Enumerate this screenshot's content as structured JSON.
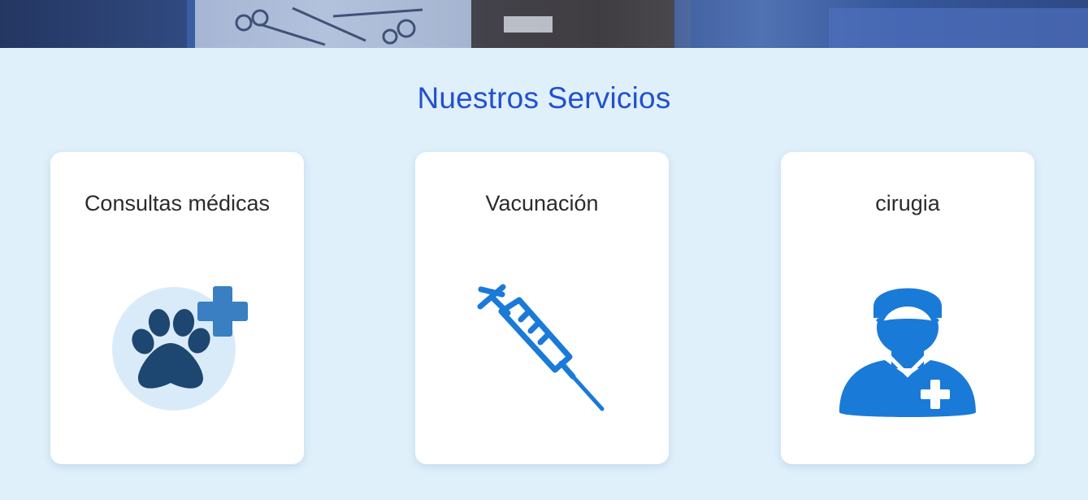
{
  "hero": {
    "image_alt": "surgical-instruments-photo"
  },
  "services": {
    "title": "Nuestros Servicios",
    "cards": [
      {
        "title": "Consultas médicas",
        "icon": "paw-medical-icon"
      },
      {
        "title": "Vacunación",
        "icon": "syringe-icon"
      },
      {
        "title": "cirugia",
        "icon": "surgeon-icon"
      }
    ]
  },
  "colors": {
    "background": "#dff0fb",
    "title": "#2350d0",
    "icon_blue": "#1a7ad8",
    "paw_dark": "#1d4670",
    "paw_circle": "#d9ebf8",
    "plus_blue": "#3a7fc2"
  }
}
